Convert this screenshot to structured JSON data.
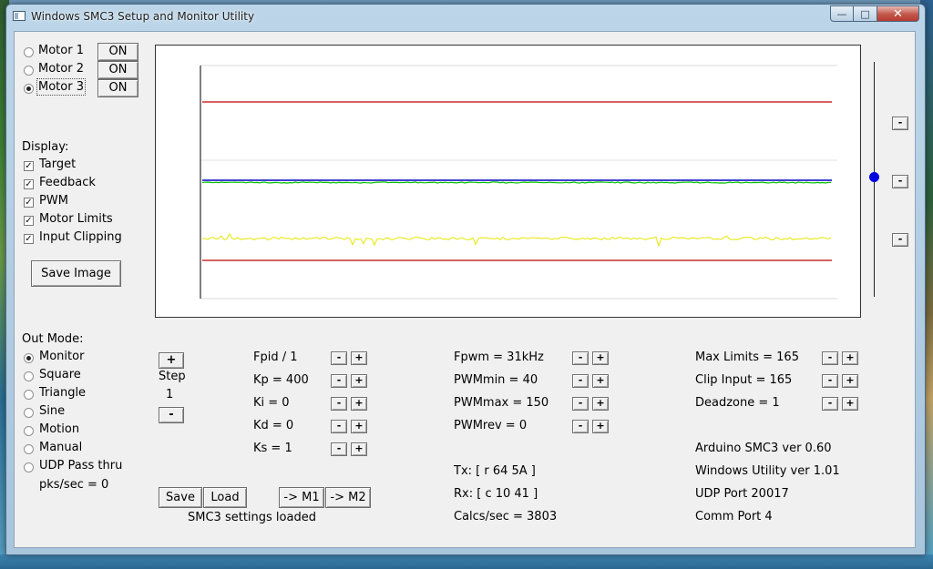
{
  "window": {
    "title": "Windows SMC3 Setup and Monitor Utility",
    "minimize_glyph": "—",
    "maximize_glyph": "□",
    "close_glyph": "✕"
  },
  "motors": [
    {
      "label": "Motor 1",
      "button": "ON",
      "selected": false
    },
    {
      "label": "Motor 2",
      "button": "ON",
      "selected": false
    },
    {
      "label": "Motor 3",
      "button": "ON",
      "selected": true
    }
  ],
  "display": {
    "heading": "Display:",
    "items": [
      {
        "label": "Target",
        "checked": true
      },
      {
        "label": "Feedback",
        "checked": true
      },
      {
        "label": "PWM",
        "checked": true
      },
      {
        "label": "Motor Limits",
        "checked": true
      },
      {
        "label": "Input Clipping",
        "checked": true
      }
    ],
    "save_image": "Save Image"
  },
  "out_mode": {
    "heading": "Out Mode:",
    "items": [
      {
        "label": "Monitor",
        "selected": true
      },
      {
        "label": "Square",
        "selected": false
      },
      {
        "label": "Triangle",
        "selected": false
      },
      {
        "label": "Sine",
        "selected": false
      },
      {
        "label": "Motion",
        "selected": false
      },
      {
        "label": "Manual",
        "selected": false
      },
      {
        "label": "UDP Pass thru",
        "selected": false
      }
    ],
    "pks_sec": "pks/sec = 0"
  },
  "step": {
    "plus": "+",
    "label": "Step",
    "value": "1",
    "minus": "-"
  },
  "pid": [
    "Fpid / 1",
    "Kp = 400",
    "Ki = 0",
    "Kd = 0",
    "Ks = 1"
  ],
  "pwm": [
    "Fpwm = 31kHz",
    "PWMmin = 40",
    "PWMmax = 150",
    "PWMrev = 0"
  ],
  "limits": [
    "Max Limits = 165",
    "Clip Input = 165",
    "Deadzone = 1"
  ],
  "comm": {
    "tx": "Tx: [ r 64 5A ]",
    "rx": "Rx: [ c 10 41 ]",
    "calcs": "Calcs/sec = 3803"
  },
  "info": {
    "arduino": "Arduino SMC3 ver 0.60",
    "utility": "Windows Utility ver 1.01",
    "udp": "UDP Port 20017",
    "comm_port": "Comm Port 4"
  },
  "buttons": {
    "save": "Save",
    "load": "Load",
    "to_m1": "-> M1",
    "to_m2": "-> M2"
  },
  "status": "SMC3 settings loaded",
  "side_buttons": [
    "-",
    "-",
    "-"
  ],
  "spin": {
    "minus": "-",
    "plus": "+"
  },
  "plot": {
    "colors": {
      "limit": "#c00000",
      "target": "#0000c0",
      "feedback": "#00c000",
      "pwm": "#e6e600"
    },
    "slider_knob": "#0000e0"
  }
}
